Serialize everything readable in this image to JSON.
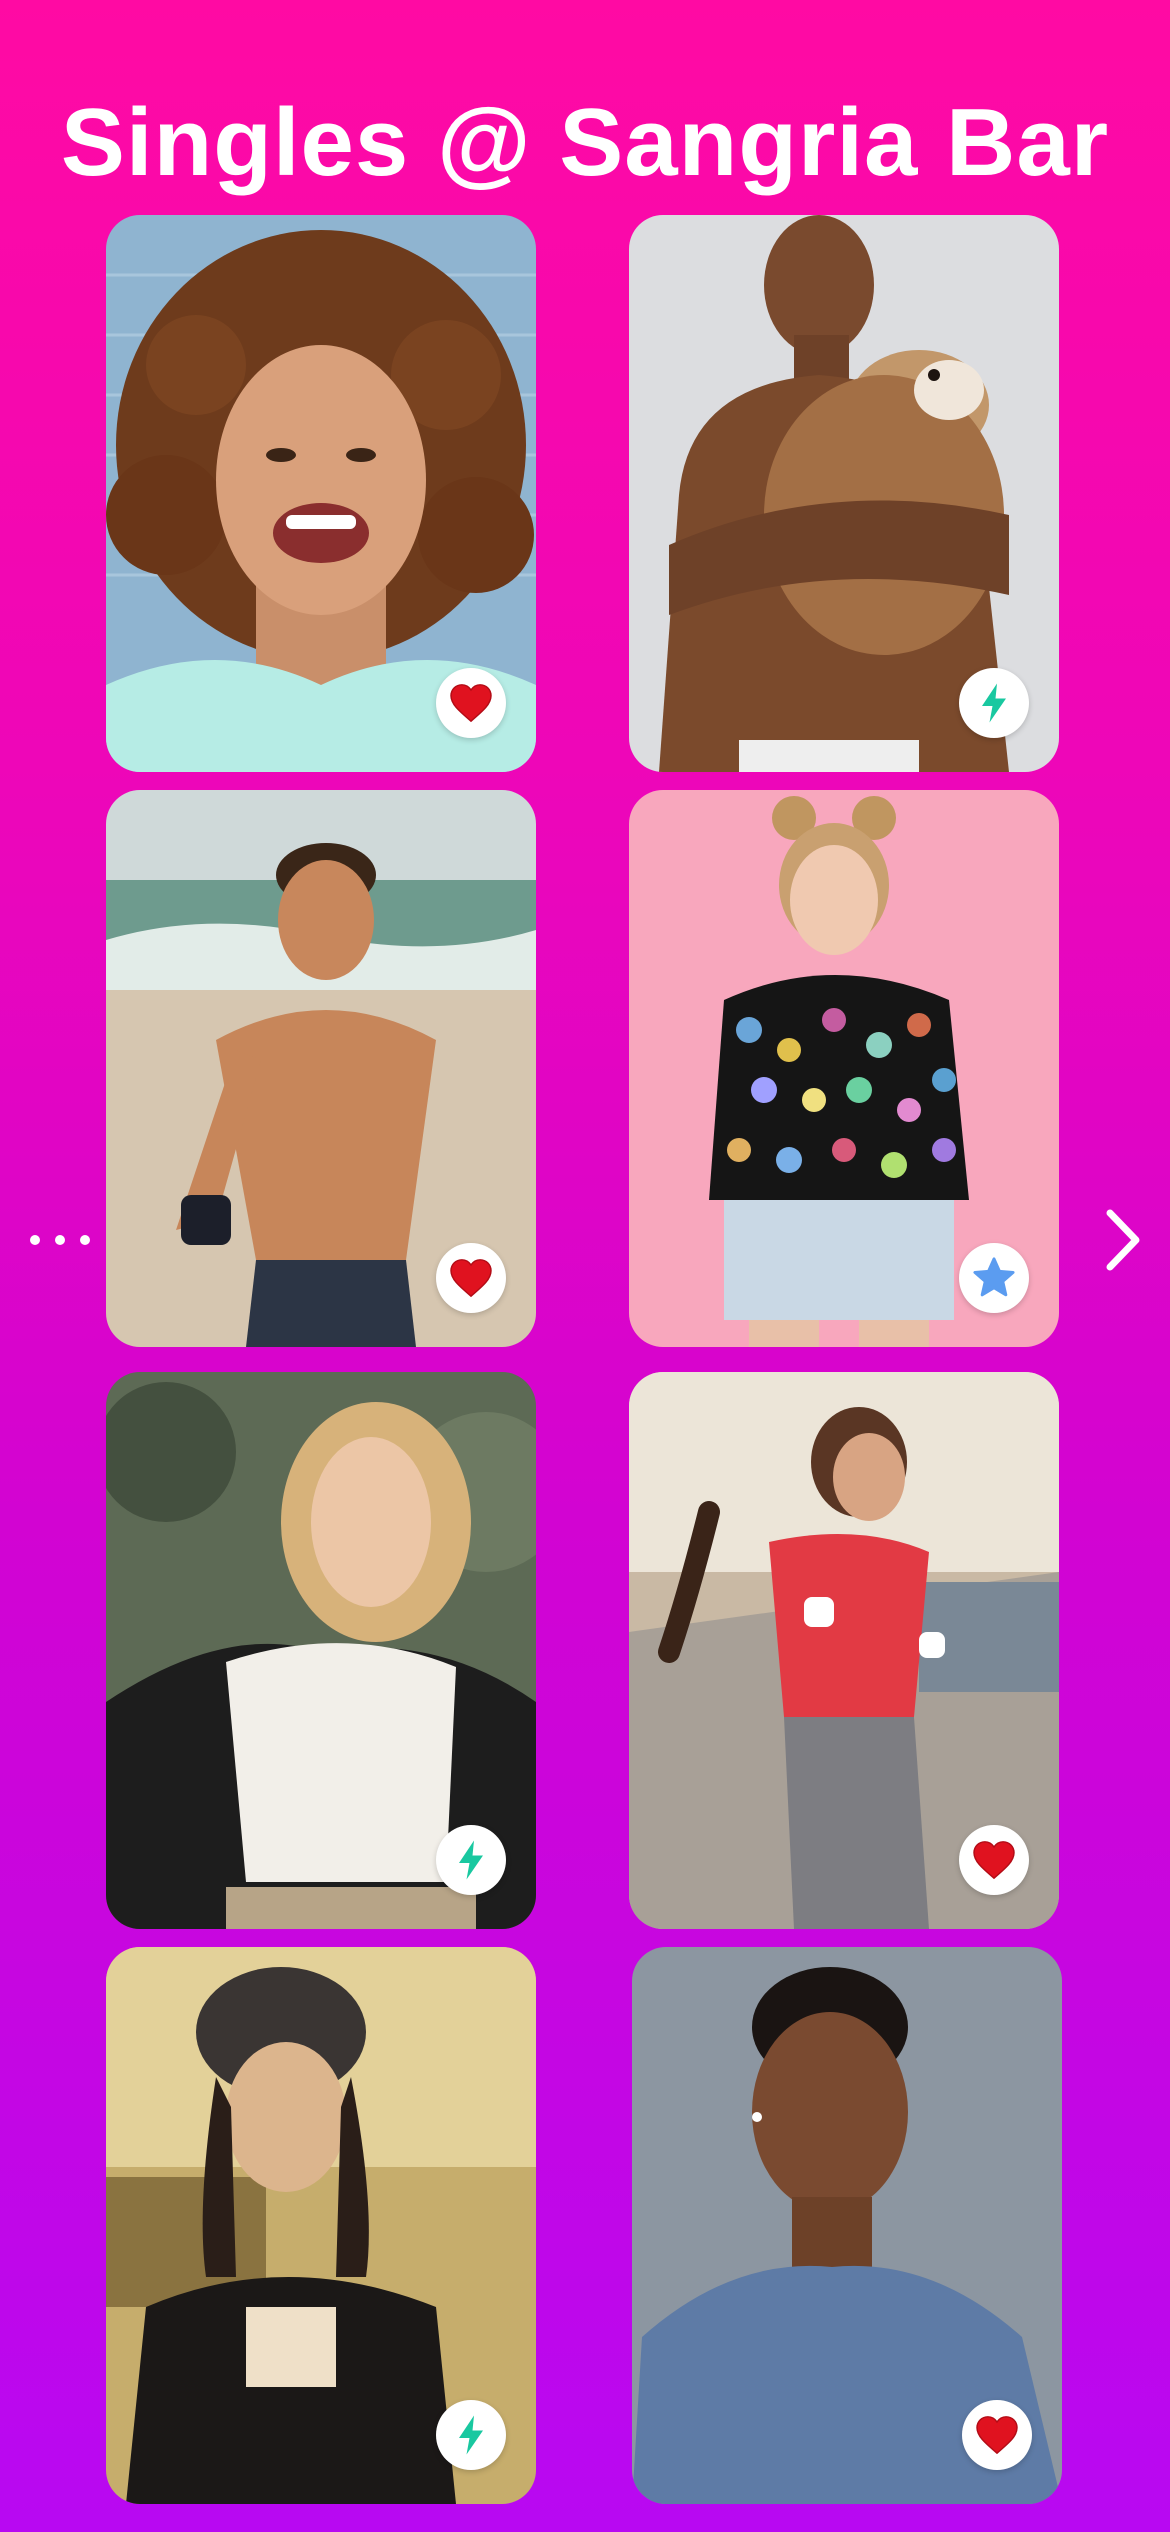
{
  "header": {
    "title": "Singles @ Sangria Bar"
  },
  "profiles": [
    {
      "id": "p1",
      "badge": "heart-icon",
      "photo": "curly-haired-woman-laughing"
    },
    {
      "id": "p2",
      "badge": "bolt-icon",
      "photo": "man-holding-bulldog"
    },
    {
      "id": "p3",
      "badge": "heart-icon",
      "photo": "shirtless-man-on-beach"
    },
    {
      "id": "p4",
      "badge": "star-icon",
      "photo": "woman-in-sequin-sweater"
    },
    {
      "id": "p5",
      "badge": "bolt-icon",
      "photo": "blonde-woman-in-leather-jacket"
    },
    {
      "id": "p6",
      "badge": "heart-icon",
      "photo": "woman-jogging"
    },
    {
      "id": "p7",
      "badge": "bolt-icon",
      "photo": "woman-in-beanie"
    },
    {
      "id": "p8",
      "badge": "heart-icon",
      "photo": "man-in-blue-tshirt"
    }
  ],
  "navigation": {
    "more_icon": "ellipsis-icon",
    "next_icon": "chevron-right-icon"
  },
  "colors": {
    "gradient_top": "#ff0aa3",
    "gradient_bottom": "#b808f2",
    "heart": "#e0121f",
    "bolt": "#19c8a0",
    "star": "#5b9cf0"
  }
}
